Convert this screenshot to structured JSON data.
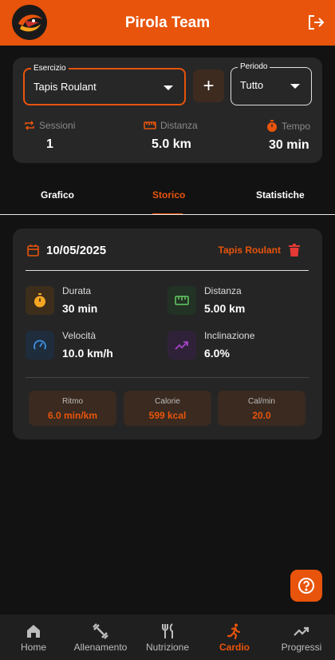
{
  "header": {
    "title": "Pirola Team"
  },
  "filters": {
    "exercise_label": "Esercizio",
    "exercise_value": "Tapis Roulant",
    "add_label": "+",
    "period_label": "Periodo",
    "period_value": "Tutto"
  },
  "summary": {
    "sessions_label": "Sessioni",
    "sessions_value": "1",
    "distance_label": "Distanza",
    "distance_value": "5.0 km",
    "time_label": "Tempo",
    "time_value": "30 min"
  },
  "tabs": [
    {
      "label": "Grafico",
      "active": false
    },
    {
      "label": "Storico",
      "active": true
    },
    {
      "label": "Statistiche",
      "active": false
    }
  ],
  "session": {
    "date": "10/05/2025",
    "exercise": "Tapis Roulant",
    "metrics": [
      {
        "label": "Durata",
        "value": "30 min"
      },
      {
        "label": "Distanza",
        "value": "5.00 km"
      },
      {
        "label": "Velocità",
        "value": "10.0 km/h"
      },
      {
        "label": "Inclinazione",
        "value": "6.0%"
      }
    ],
    "pills": [
      {
        "label": "Ritmo",
        "value": "6.0 min/km"
      },
      {
        "label": "Calorie",
        "value": "599 kcal"
      },
      {
        "label": "Cal/min",
        "value": "20.0"
      }
    ]
  },
  "nav": [
    {
      "label": "Home",
      "active": false
    },
    {
      "label": "Allenamento",
      "active": false
    },
    {
      "label": "Nutrizione",
      "active": false
    },
    {
      "label": "Cardio",
      "active": true
    },
    {
      "label": "Progressi",
      "active": false
    }
  ],
  "colors": {
    "accent": "#e8540b",
    "background": "#121212",
    "card": "#272727"
  }
}
